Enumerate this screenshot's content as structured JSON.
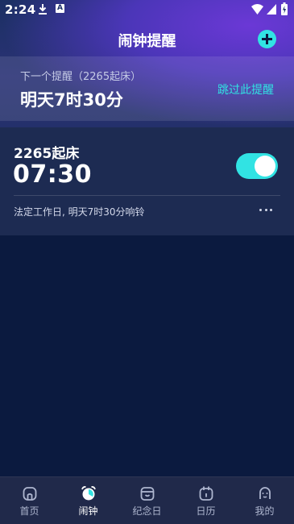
{
  "status_bar": {
    "time": "2:24",
    "icons": [
      "download-icon",
      "a-notification-icon",
      "wifi-icon",
      "signal-icon",
      "battery-icon"
    ]
  },
  "header": {
    "title": "闹钟提醒",
    "add_icon": "plus-circle-icon"
  },
  "next_reminder": {
    "subtitle": "下一个提醒（2265起床）",
    "time": "明天7时30分",
    "skip_label": "跳过此提醒"
  },
  "alarm": {
    "name": "2265起床",
    "time": "07:30",
    "enabled": true,
    "description": "法定工作日, 明天7时30分响铃"
  },
  "nav": {
    "items": [
      {
        "label": "首页",
        "icon": "home-icon"
      },
      {
        "label": "闹钟",
        "icon": "alarm-clock-icon"
      },
      {
        "label": "纪念日",
        "icon": "gift-box-icon"
      },
      {
        "label": "日历",
        "icon": "calendar-icon"
      },
      {
        "label": "我的",
        "icon": "profile-icon"
      }
    ],
    "active_index": 1
  },
  "colors": {
    "accent": "#31e3e3",
    "background": "#0b1a3f",
    "card": "#1d2b52",
    "nav_bg": "#20294a"
  }
}
